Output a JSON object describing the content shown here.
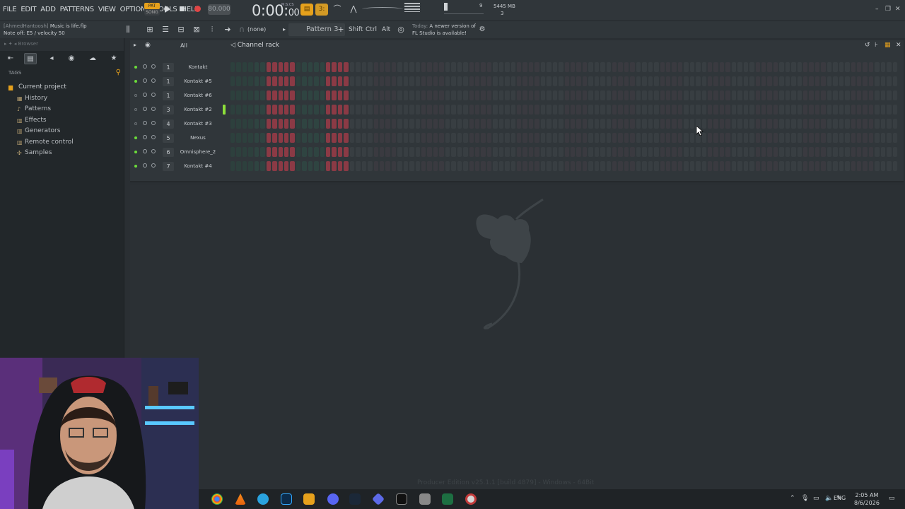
{
  "menu": [
    "FILE",
    "EDIT",
    "ADD",
    "PATTERNS",
    "VIEW",
    "OPTIONS",
    "TOOLS",
    "HELP"
  ],
  "transport": {
    "pat_label": "PAT",
    "song_label": "SONG",
    "tempo": "80.000",
    "time_main": "0:00:",
    "time_sub": "00",
    "time_unit": "M:S:CS",
    "cpu": "9",
    "memory": "5445 MB",
    "poly": "3"
  },
  "project": {
    "user": "[AhmedHantoosh]",
    "file": "Music is life.flp",
    "hint": "Note off: E5 / velocity 50"
  },
  "toolbar2": {
    "none_label": "(none)",
    "pattern": "Pattern 3",
    "shift": "Shift",
    "ctrl": "Ctrl",
    "alt": "Alt",
    "news_today": "Today:",
    "news_line1": "A newer version of",
    "news_line2": "FL Studio is available!"
  },
  "browser": {
    "header": "Browser",
    "tags_label": "TAGS",
    "items": [
      {
        "label": "Current project",
        "icon": "folder-icon"
      },
      {
        "label": "History",
        "icon": "history-icon"
      },
      {
        "label": "Patterns",
        "icon": "pattern-icon"
      },
      {
        "label": "Effects",
        "icon": "effects-icon"
      },
      {
        "label": "Generators",
        "icon": "generators-icon"
      },
      {
        "label": "Remote control",
        "icon": "remote-icon"
      },
      {
        "label": "Samples",
        "icon": "samples-icon"
      }
    ]
  },
  "rack": {
    "filter": "All",
    "title": "Channel rack",
    "channels": [
      {
        "num": "1",
        "name": "Kontakt",
        "on": true
      },
      {
        "num": "1",
        "name": "Kontakt #5",
        "on": true
      },
      {
        "num": "1",
        "name": "Kontakt #6",
        "on": false
      },
      {
        "num": "3",
        "name": "Kontakt #2",
        "on": false,
        "selected": true
      },
      {
        "num": "4",
        "name": "Kontakt #3",
        "on": false
      },
      {
        "num": "5",
        "name": "Nexus",
        "on": true
      },
      {
        "num": "6",
        "name": "Omnisphere_2",
        "on": true
      },
      {
        "num": "7",
        "name": "Kontakt #4",
        "on": true
      }
    ],
    "steps_per_row": 112,
    "active_step_ranges": [
      [
        6,
        10
      ],
      [
        16,
        20
      ]
    ],
    "colors": {
      "step_red": "#8b3a45",
      "step_dark": "#3a4a48",
      "meter": "#8de03a"
    }
  },
  "workspace": {
    "watermark": "Producer Edition v25.1.1 [build 4879] - Windows - 64Bit"
  },
  "taskbar": {
    "lang": "ENG",
    "time": "2:05 AM",
    "date": "8/6/2026"
  }
}
